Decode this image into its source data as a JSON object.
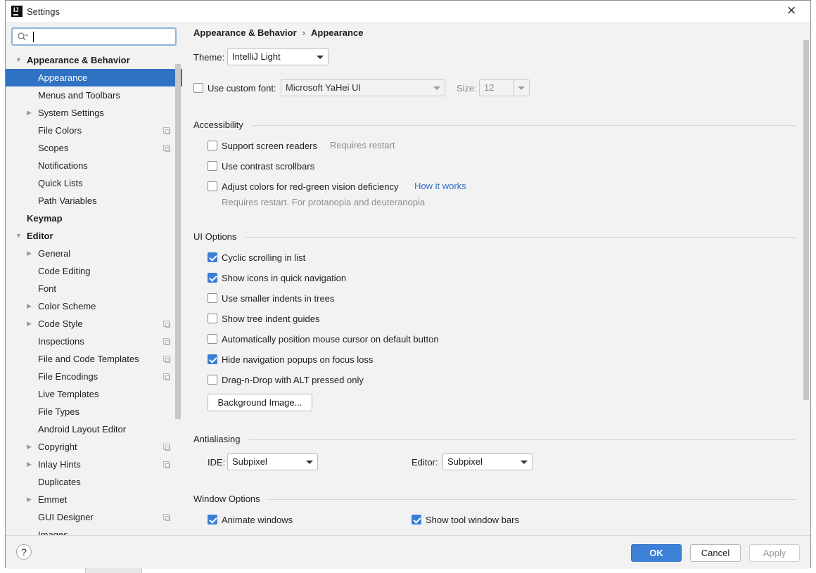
{
  "window": {
    "title": "Settings",
    "app_icon_text": "IJ",
    "close_glyph": "×"
  },
  "search": {
    "value": "",
    "placeholder": ""
  },
  "sidebar": {
    "items": [
      {
        "label": "Appearance & Behavior",
        "level": 0,
        "expander": "expanded",
        "bold": true
      },
      {
        "label": "Appearance",
        "level": 1,
        "selected": true
      },
      {
        "label": "Menus and Toolbars",
        "level": 1
      },
      {
        "label": "System Settings",
        "level": 1,
        "expander": "collapsed"
      },
      {
        "label": "File Colors",
        "level": 1,
        "copy_icon": true
      },
      {
        "label": "Scopes",
        "level": 1,
        "copy_icon": true
      },
      {
        "label": "Notifications",
        "level": 1
      },
      {
        "label": "Quick Lists",
        "level": 1
      },
      {
        "label": "Path Variables",
        "level": 1
      },
      {
        "label": "Keymap",
        "level": 0,
        "bold": true
      },
      {
        "label": "Editor",
        "level": 0,
        "expander": "expanded",
        "bold": true
      },
      {
        "label": "General",
        "level": 1,
        "expander": "collapsed"
      },
      {
        "label": "Code Editing",
        "level": 1
      },
      {
        "label": "Font",
        "level": 1
      },
      {
        "label": "Color Scheme",
        "level": 1,
        "expander": "collapsed"
      },
      {
        "label": "Code Style",
        "level": 1,
        "expander": "collapsed",
        "copy_icon": true
      },
      {
        "label": "Inspections",
        "level": 1,
        "copy_icon": true
      },
      {
        "label": "File and Code Templates",
        "level": 1,
        "copy_icon": true
      },
      {
        "label": "File Encodings",
        "level": 1,
        "copy_icon": true
      },
      {
        "label": "Live Templates",
        "level": 1
      },
      {
        "label": "File Types",
        "level": 1
      },
      {
        "label": "Android Layout Editor",
        "level": 1
      },
      {
        "label": "Copyright",
        "level": 1,
        "expander": "collapsed",
        "copy_icon": true
      },
      {
        "label": "Inlay Hints",
        "level": 1,
        "expander": "collapsed",
        "copy_icon": true
      },
      {
        "label": "Duplicates",
        "level": 1
      },
      {
        "label": "Emmet",
        "level": 1,
        "expander": "collapsed"
      },
      {
        "label": "GUI Designer",
        "level": 1,
        "copy_icon": true
      },
      {
        "label": "Images",
        "level": 1
      }
    ]
  },
  "breadcrumb": {
    "parent": "Appearance & Behavior",
    "separator": "›",
    "current": "Appearance"
  },
  "appearance": {
    "theme_label": "Theme:",
    "theme_value": "IntelliJ Light",
    "custom_font_label": "Use custom font:",
    "custom_font_checked": false,
    "font_value": "Microsoft YaHei UI",
    "size_label": "Size:",
    "size_value": "12"
  },
  "accessibility": {
    "title": "Accessibility",
    "screen_readers_label": "Support screen readers",
    "screen_readers_checked": false,
    "screen_readers_hint": "Requires restart",
    "contrast_scrollbars_label": "Use contrast scrollbars",
    "contrast_scrollbars_checked": false,
    "color_deficiency_label": "Adjust colors for red-green vision deficiency",
    "color_deficiency_checked": false,
    "how_it_works_link": "How it works",
    "color_deficiency_hint": "Requires restart. For protanopia and deuteranopia"
  },
  "ui_options": {
    "title": "UI Options",
    "options": [
      {
        "label": "Cyclic scrolling in list",
        "checked": true
      },
      {
        "label": "Show icons in quick navigation",
        "checked": true
      },
      {
        "label": "Use smaller indents in trees",
        "checked": false
      },
      {
        "label": "Show tree indent guides",
        "checked": false
      },
      {
        "label": "Automatically position mouse cursor on default button",
        "checked": false
      },
      {
        "label": "Hide navigation popups on focus loss",
        "checked": true
      },
      {
        "label": "Drag-n-Drop with ALT pressed only",
        "checked": false
      }
    ],
    "background_image_button": "Background Image..."
  },
  "antialiasing": {
    "title": "Antialiasing",
    "ide_label": "IDE:",
    "ide_value": "Subpixel",
    "editor_label": "Editor:",
    "editor_value": "Subpixel"
  },
  "window_options": {
    "title": "Window Options",
    "animate_windows_label": "Animate windows",
    "animate_windows_checked": true,
    "show_tool_window_bars_label": "Show tool window bars",
    "show_tool_window_bars_checked": true
  },
  "footer": {
    "help_glyph": "?",
    "ok_label": "OK",
    "cancel_label": "Cancel",
    "apply_label": "Apply",
    "apply_enabled": false
  },
  "colors": {
    "selection": "#2f72c4",
    "accent": "#3c80d7",
    "link": "#2e6fc5",
    "background": "#f2f2f2"
  },
  "icons": {
    "search": "search-icon",
    "close": "close-icon",
    "expand": "chevron-right-icon",
    "collapse": "chevron-down-icon",
    "project_scope": "copy-icon",
    "dropdown": "dropdown-arrow-icon"
  }
}
